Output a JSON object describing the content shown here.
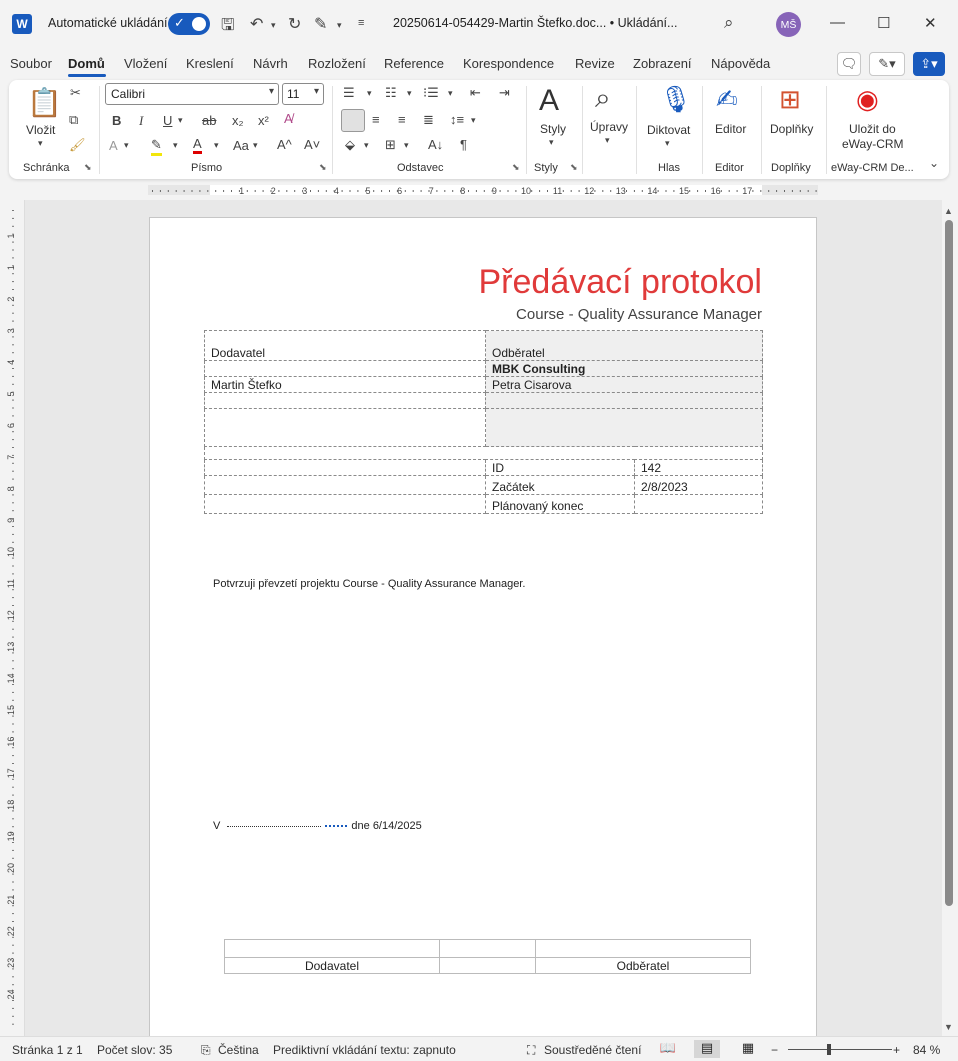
{
  "titlebar": {
    "app_letter": "W",
    "autosave_label": "Automatické ukládání",
    "document_title": "20250614-054429-Martin Štefko.doc... • Ukládání...",
    "avatar_initials": "MŠ"
  },
  "tabs": [
    "Soubor",
    "Domů",
    "Vložení",
    "Kreslení",
    "Návrh",
    "Rozložení",
    "Reference",
    "Korespondence",
    "Revize",
    "Zobrazení",
    "Nápověda"
  ],
  "active_tab": "Domů",
  "ribbon": {
    "paste_label": "Vložit",
    "font_name": "Calibri",
    "font_size": "11",
    "styles_label": "Styly",
    "editing_label": "Úpravy",
    "dictate_label": "Diktovat",
    "editor_label": "Editor",
    "addins_label": "Doplňky",
    "eway_label_1": "Uložit do",
    "eway_label_2": "eWay-CRM",
    "groups": {
      "clipboard": "Schránka",
      "font": "Písmo",
      "paragraph": "Odstavec",
      "styles": "Styly",
      "voice": "Hlas",
      "editor": "Editor",
      "addins": "Doplňky",
      "eway": "eWay-CRM De..."
    }
  },
  "ruler_numbers": [
    "1",
    "2",
    "3",
    "4",
    "5",
    "6",
    "7",
    "8",
    "9",
    "10",
    "11",
    "12",
    "13",
    "14",
    "15",
    "16",
    "17"
  ],
  "vruler_numbers": [
    "1",
    "1",
    "2",
    "3",
    "4",
    "5",
    "6",
    "7",
    "8",
    "9",
    "10",
    "11",
    "12",
    "13",
    "14",
    "15",
    "16",
    "17",
    "18",
    "19",
    "20",
    "21",
    "22",
    "23",
    "24"
  ],
  "document": {
    "title": "Předávací protokol",
    "subtitle": "Course - Quality Assurance Manager",
    "supplier_label": "Dodavatel",
    "customer_label": "Odběratel",
    "customer_company": "MBK Consulting",
    "supplier_person": "Martin Štefko",
    "customer_person": "Petra Cisarova",
    "id_label": "ID",
    "id_value": "142",
    "start_label": "Začátek",
    "start_value": "2/8/2023",
    "planned_end_label": "Plánovaný konec",
    "planned_end_value": "",
    "confirmation": "Potvrzuji převzetí projektu Course - Quality Assurance Manager.",
    "place_prefix": "V",
    "date_text": "dne 6/14/2025",
    "sign_supplier": "Dodavatel",
    "sign_customer": "Odběratel"
  },
  "statusbar": {
    "page": "Stránka 1 z 1",
    "words": "Počet slov: 35",
    "language": "Čeština",
    "predictive": "Prediktivní vkládání textu: zapnuto",
    "focus": "Soustředěné čtení",
    "zoom": "84 %"
  },
  "colors": {
    "accent": "#185abd",
    "title_red": "#e03a3a",
    "avatar": "#8764b8"
  }
}
